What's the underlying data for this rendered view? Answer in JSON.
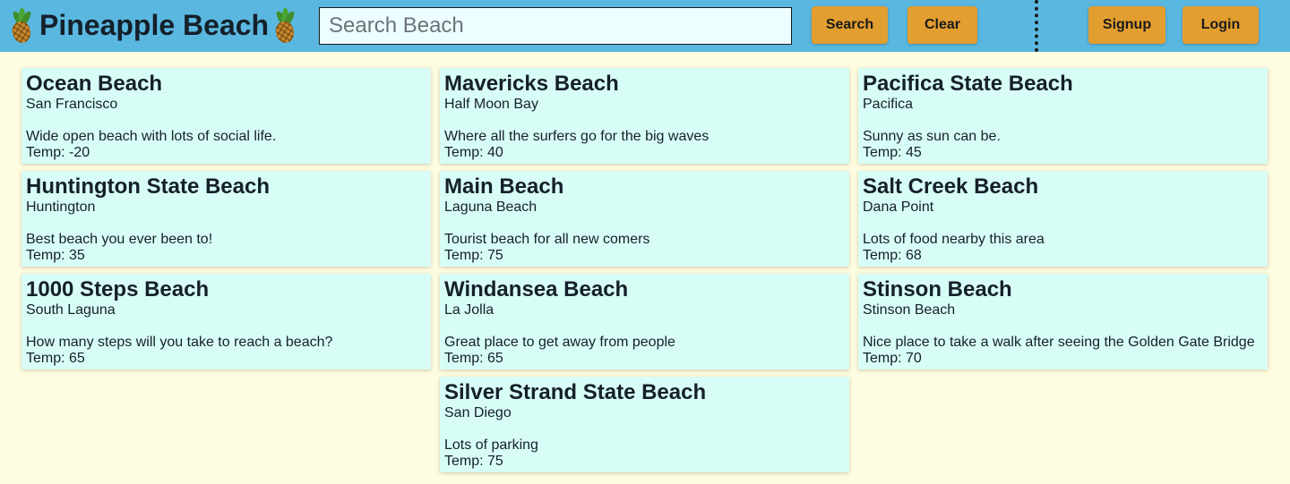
{
  "header": {
    "title": "Pineapple Beach",
    "brand_icon": "pineapple-icon",
    "search_placeholder": "Search Beach",
    "search_value": "",
    "search_label": "Search",
    "clear_label": "Clear",
    "signup_label": "Signup",
    "login_label": "Login"
  },
  "colors": {
    "header_bg": "#5ab8e0",
    "page_bg": "#fffde1",
    "card_bg": "#d8fdf6",
    "button_bg": "#e39e30"
  },
  "columns": [
    [
      {
        "name": "Ocean Beach",
        "location": "San Francisco",
        "description": "Wide open beach with lots of social life.",
        "temp": "Temp: -20"
      },
      {
        "name": "Huntington State Beach",
        "location": "Huntington",
        "description": "Best beach you ever been to!",
        "temp": "Temp: 35"
      },
      {
        "name": "1000 Steps Beach",
        "location": "South Laguna",
        "description": "How many steps will you take to reach a beach?",
        "temp": "Temp: 65"
      }
    ],
    [
      {
        "name": "Mavericks Beach",
        "location": "Half Moon Bay",
        "description": "Where all the surfers go for the big waves",
        "temp": "Temp: 40"
      },
      {
        "name": "Main Beach",
        "location": "Laguna Beach",
        "description": "Tourist beach for all new comers",
        "temp": "Temp: 75"
      },
      {
        "name": "Windansea Beach",
        "location": "La Jolla",
        "description": "Great place to get away from people",
        "temp": "Temp: 65"
      },
      {
        "name": "Silver Strand State Beach",
        "location": "San Diego",
        "description": "Lots of parking",
        "temp": "Temp: 75"
      }
    ],
    [
      {
        "name": "Pacifica State Beach",
        "location": "Pacifica",
        "description": "Sunny as sun can be.",
        "temp": "Temp: 45"
      },
      {
        "name": "Salt Creek Beach",
        "location": "Dana Point",
        "description": "Lots of food nearby this area",
        "temp": "Temp: 68"
      },
      {
        "name": "Stinson Beach",
        "location": "Stinson Beach",
        "description": "Nice place to take a walk after seeing the Golden Gate Bridge",
        "temp": "Temp: 70"
      }
    ]
  ]
}
